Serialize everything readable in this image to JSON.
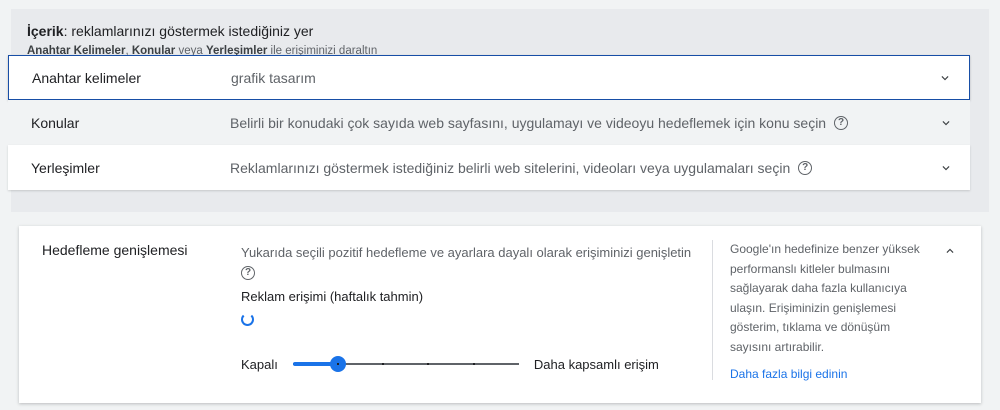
{
  "content": {
    "title_bold": "İçerik",
    "title_rest": ": reklamlarınızı göstermek istediğiniz yer",
    "subtitle": {
      "b1": "Anahtar Kelimeler",
      "sep1": ", ",
      "b2": "Konular",
      "sep2": " veya ",
      "b3": "Yerleşimler",
      "rest": " ile erişiminizi daraltın"
    },
    "rows": [
      {
        "label": "Anahtar kelimeler",
        "desc": "grafik tasarım",
        "icon": "chevron-down-icon"
      },
      {
        "label": "Konular",
        "desc": "Belirli bir konudaki çok sayıda web sayfasını, uygulamayı ve videoyu hedeflemek için konu seçin",
        "icon": "chevron-down-icon"
      },
      {
        "label": "Yerleşimler",
        "desc": "Reklamlarınızı göstermek istediğiniz belirli web sitelerini, videoları veya uygulamaları seçin",
        "icon": "chevron-down-icon"
      }
    ]
  },
  "expansion": {
    "label": "Hedefleme genişlemesi",
    "desc": "Yukarıda seçili pozitif hedefleme ve ayarlara dayalı olarak erişiminizi genişletin",
    "reach_label": "Reklam erişimi (haftalık tahmin)",
    "slider": {
      "min_label": "Kapalı",
      "max_label": "Daha kapsamlı erişim",
      "steps": 5,
      "level": 1
    },
    "side_help": "Google'ın hedefinize benzer yüksek performanslı kitleler bulmasını sağlayarak daha fazla kullanıcıya ulaşın. Erişiminizin genişlemesi gösterim, tıklama ve dönüşüm sayısını artırabilir.",
    "link": "Daha fazla bilgi edinin",
    "icon": "chevron-up-icon"
  },
  "colors": {
    "accent": "#1a73e8",
    "focus_border": "#174ea6"
  }
}
